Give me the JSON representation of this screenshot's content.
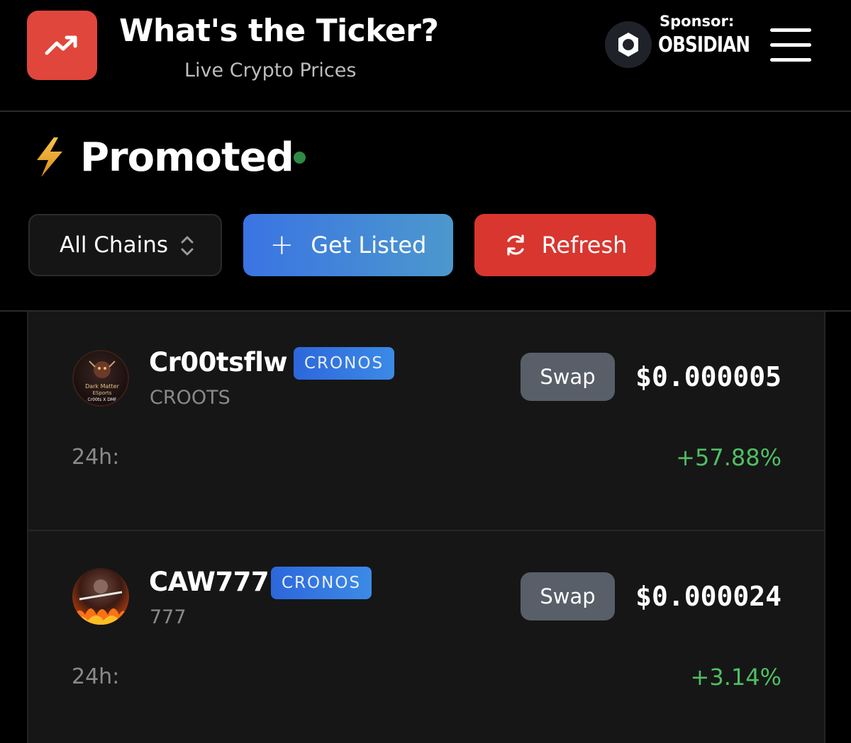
{
  "header": {
    "title": "What's the Ticker?",
    "subtitle": "Live Crypto Prices",
    "logo_icon": "trending-up-icon",
    "sponsor_label": "Sponsor:",
    "sponsor_name": "OBSIDIAN",
    "menu_icon": "hamburger-menu-icon"
  },
  "section": {
    "icon": "lightning-bolt-icon",
    "title": "Promoted",
    "status": "live"
  },
  "toolbar": {
    "chain_select_value": "All Chains",
    "get_listed_label": "Get Listed",
    "refresh_label": "Refresh"
  },
  "tokens": [
    {
      "name": "Cr00tsflw",
      "chain": "CRONOS",
      "symbol": "CROOTS",
      "avatar_text": [
        "Dark Matter",
        "ESports",
        "Cr00ts X DMF"
      ],
      "swap_label": "Swap",
      "price": "$0.000005",
      "change_label": "24h:",
      "change": "+57.88%"
    },
    {
      "name": "CAW777",
      "chain": "CRONOS",
      "symbol": "777",
      "swap_label": "Swap",
      "price": "$0.000024",
      "change_label": "24h:",
      "change": "+3.14%"
    }
  ],
  "colors": {
    "background": "#000000",
    "card": "#161616",
    "logo": "#e0463c",
    "refresh": "#d8362f",
    "get_listed_start": "#3a74e3",
    "get_listed_end": "#4c98cd",
    "positive": "#4fbf63",
    "live_dot": "#2f8a45"
  }
}
